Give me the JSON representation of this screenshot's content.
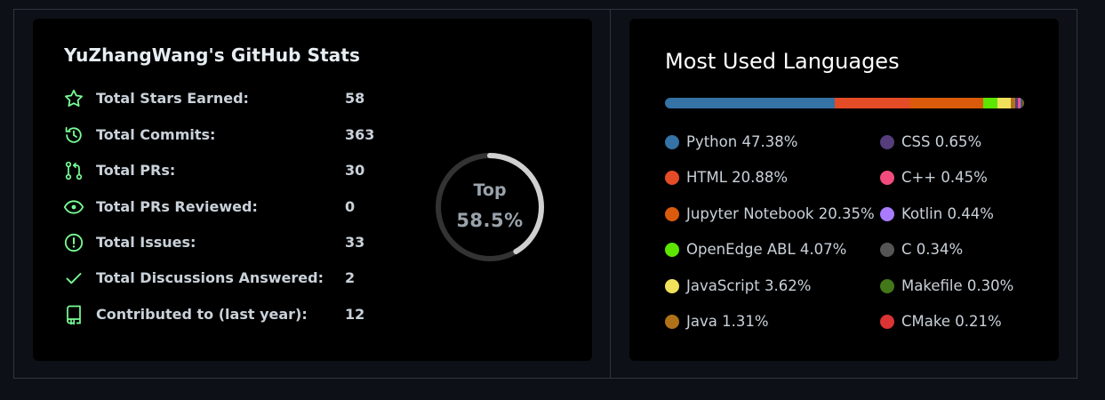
{
  "stats": {
    "title": "YuZhangWang's GitHub Stats",
    "accent_color": "#79ff97",
    "rows": [
      {
        "icon": "star-icon",
        "label": "Total Stars Earned:",
        "value": "58"
      },
      {
        "icon": "history-icon",
        "label": "Total Commits:",
        "value": "363"
      },
      {
        "icon": "pull-request-icon",
        "label": "Total PRs:",
        "value": "30"
      },
      {
        "icon": "eye-icon",
        "label": "Total PRs Reviewed:",
        "value": "0"
      },
      {
        "icon": "issue-icon",
        "label": "Total Issues:",
        "value": "33"
      },
      {
        "icon": "check-icon",
        "label": "Total Discussions Answered:",
        "value": "2"
      },
      {
        "icon": "repo-icon",
        "label": "Contributed to (last year):",
        "value": "12"
      }
    ],
    "rank": {
      "label": "Top",
      "value": "58.5%",
      "progress_fraction": 0.415
    }
  },
  "languages": {
    "title": "Most Used Languages",
    "items": [
      {
        "name": "Python",
        "percent": "47.38%",
        "pct": 47.38,
        "color": "#3572A5"
      },
      {
        "name": "HTML",
        "percent": "20.88%",
        "pct": 20.88,
        "color": "#e34c26"
      },
      {
        "name": "Jupyter Notebook",
        "percent": "20.35%",
        "pct": 20.35,
        "color": "#DA5B0B"
      },
      {
        "name": "OpenEdge ABL",
        "percent": "4.07%",
        "pct": 4.07,
        "color": "#5ce600"
      },
      {
        "name": "JavaScript",
        "percent": "3.62%",
        "pct": 3.62,
        "color": "#f1e05a"
      },
      {
        "name": "Java",
        "percent": "1.31%",
        "pct": 1.31,
        "color": "#b07219"
      },
      {
        "name": "CSS",
        "percent": "0.65%",
        "pct": 0.65,
        "color": "#563d7c"
      },
      {
        "name": "C++",
        "percent": "0.45%",
        "pct": 0.45,
        "color": "#f34b7d"
      },
      {
        "name": "Kotlin",
        "percent": "0.44%",
        "pct": 0.44,
        "color": "#A97BFF"
      },
      {
        "name": "C",
        "percent": "0.34%",
        "pct": 0.34,
        "color": "#555555"
      },
      {
        "name": "Makefile",
        "percent": "0.30%",
        "pct": 0.3,
        "color": "#427819"
      },
      {
        "name": "CMake",
        "percent": "0.21%",
        "pct": 0.21,
        "color": "#DA3434"
      }
    ]
  }
}
